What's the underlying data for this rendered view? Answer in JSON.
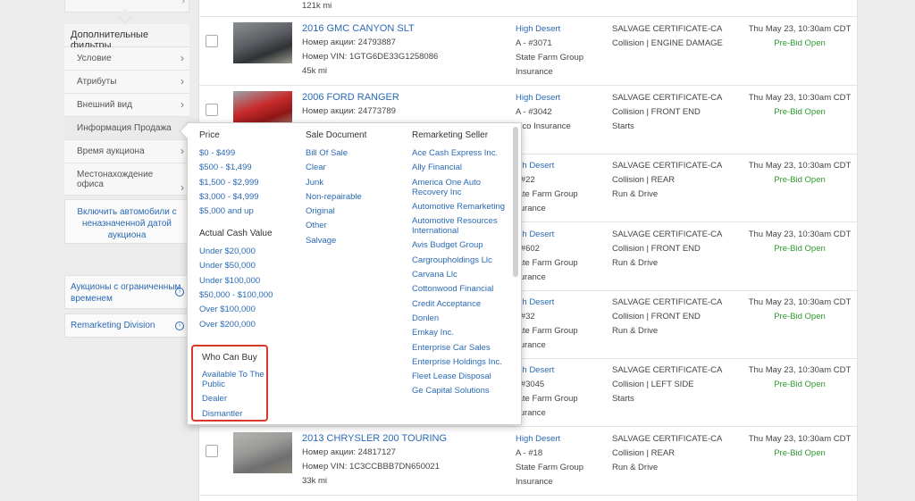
{
  "sidebar": {
    "heading": "Дополнительные фильтры",
    "items": [
      {
        "label": "Условие"
      },
      {
        "label": "Атрибуты"
      },
      {
        "label": "Внешний вид"
      },
      {
        "label": "Информация Продажа"
      },
      {
        "label": "Время аукциона"
      },
      {
        "label": "Местонахождение офиса"
      }
    ],
    "include_button": "Включить автомобили с неназначенной датой аукциона",
    "links": [
      {
        "label": "Аукционы с ограниченным временем"
      },
      {
        "label": "Remarketing Division"
      }
    ]
  },
  "rows": [
    {
      "top_mileage": "121k mi"
    },
    {
      "title": "2016 GMC CANYON SLT",
      "stock": "Номер акции: 24793887",
      "vin": "Номер VIN: 1GTG6DE33G1258086",
      "mileage": "45k mi",
      "location": "High Desert",
      "lane": "A - #3071",
      "seller1": "State Farm Group",
      "seller2": "Insurance",
      "doc": "SALVAGE CERTIFICATE-CA",
      "damage": "Collision | ENGINE DAMAGE",
      "date": "Thu May 23, 10:30am CDT",
      "status": "Pre-Bid Open"
    },
    {
      "title": "2006 FORD RANGER",
      "stock": "Номер акции: 24773789",
      "location": "High Desert",
      "lane": "A - #3042",
      "seller1": "eico Insurance",
      "doc": "SALVAGE CERTIFICATE-CA",
      "damage": "Collision | FRONT END",
      "runs": "Starts",
      "date": "Thu May 23, 10:30am CDT",
      "status": "Pre-Bid Open"
    },
    {
      "location": "igh Desert",
      "lane": "- #22",
      "seller1": "tate Farm Group",
      "seller2": "surance",
      "doc": "SALVAGE CERTIFICATE-CA",
      "damage": "Collision | REAR",
      "runs": "Run & Drive",
      "date": "Thu May 23, 10:30am CDT",
      "status": "Pre-Bid Open"
    },
    {
      "location": "igh Desert",
      "lane": "- #602",
      "seller1": "tate Farm Group",
      "seller2": "surance",
      "doc": "SALVAGE CERTIFICATE-CA",
      "damage": "Collision | FRONT END",
      "runs": "Run & Drive",
      "date": "Thu May 23, 10:30am CDT",
      "status": "Pre-Bid Open"
    },
    {
      "location": "igh Desert",
      "lane": "- #32",
      "seller1": "tate Farm Group",
      "seller2": "surance",
      "doc": "SALVAGE CERTIFICATE-CA",
      "damage": "Collision | FRONT END",
      "runs": "Run & Drive",
      "date": "Thu May 23, 10:30am CDT",
      "status": "Pre-Bid Open"
    },
    {
      "location": "igh Desert",
      "lane": "- #3045",
      "seller1": "tate Farm Group",
      "seller2": "surance",
      "doc": "SALVAGE CERTIFICATE-CA",
      "damage": "Collision | LEFT SIDE",
      "runs": "Starts",
      "date": "Thu May 23, 10:30am CDT",
      "status": "Pre-Bid Open"
    },
    {
      "title": "2013 CHRYSLER 200 TOURING",
      "stock": "Номер акции: 24817127",
      "vin": "Номер VIN: 1C3CCBBB7DN650021",
      "mileage": "33k mi",
      "location": "High Desert",
      "lane": "A - #18",
      "seller1": "State Farm Group",
      "seller2": "Insurance",
      "doc": "SALVAGE CERTIFICATE-CA",
      "damage": "Collision | REAR",
      "runs": "Run & Drive",
      "date": "Thu May 23, 10:30am CDT",
      "status": "Pre-Bid Open"
    }
  ],
  "popup": {
    "price": {
      "heading": "Price",
      "options": [
        "$0 - $499",
        "$500 - $1,499",
        "$1,500 - $2,999",
        "$3,000 - $4,999",
        "$5,000 and up"
      ]
    },
    "acv": {
      "heading": "Actual Cash Value",
      "options": [
        "Under $20,000",
        "Under $50,000",
        "Under $100,000",
        "$50,000 - $100,000",
        "Over $100,000",
        "Over $200,000"
      ]
    },
    "who": {
      "heading": "Who Can Buy",
      "options": [
        "Available To The Public",
        "Dealer",
        "Dismantler"
      ]
    },
    "sale_document": {
      "heading": "Sale Document",
      "options": [
        "Bill Of Sale",
        "Clear",
        "Junk",
        "Non-repairable",
        "Original",
        "Other",
        "Salvage"
      ]
    },
    "remarketing": {
      "heading": "Remarketing Seller",
      "options": [
        "Ace Cash Express Inc.",
        "Ally Financial",
        "America One Auto Recovery Inc",
        "Automotive Remarketing",
        "Automotive Resources International",
        "Avis Budget Group",
        "Cargroupholdings Llc",
        "Carvana Llc",
        "Cottonwood Financial",
        "Credit Acceptance",
        "Donlen",
        "Emkay Inc.",
        "Enterprise Car Sales",
        "Enterprise Holdings Inc.",
        "Fleet Lease Disposal",
        "Ge Capital Solutions"
      ]
    }
  },
  "colors": {
    "link": "#2a6ab5",
    "status_green": "#2e9a2e",
    "highlight_red": "#d9392a"
  }
}
